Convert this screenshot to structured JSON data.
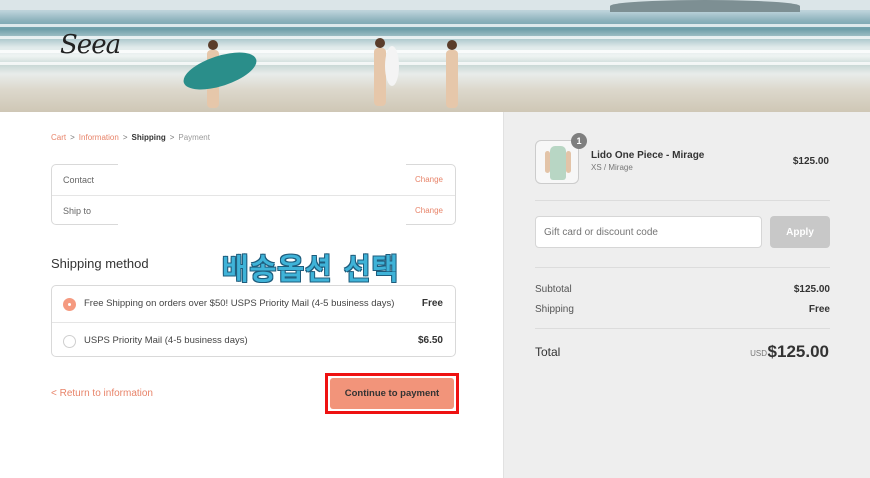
{
  "brand": {
    "logo": "Seea"
  },
  "breadcrumb": [
    {
      "label": "Cart",
      "state": "link"
    },
    {
      "label": "Information",
      "state": "link"
    },
    {
      "label": "Shipping",
      "state": "current"
    },
    {
      "label": "Payment",
      "state": "upcoming"
    }
  ],
  "review": {
    "contact_label": "Contact",
    "ship_to_label": "Ship to",
    "change_label": "Change"
  },
  "shipping": {
    "title": "Shipping method",
    "annotation": "배송옵션 선택",
    "options": [
      {
        "label": "Free Shipping on orders over $50! USPS Priority Mail (4-5 business days)",
        "price": "Free",
        "selected": true
      },
      {
        "label": "USPS Priority Mail (4-5 business days)",
        "price": "$6.50",
        "selected": false
      }
    ]
  },
  "actions": {
    "return_label": "< Return to information",
    "continue_label": "Continue to payment"
  },
  "summary": {
    "item": {
      "quantity": "1",
      "name": "Lido One Piece - Mirage",
      "variant": "XS / Mirage",
      "price": "$125.00"
    },
    "discount_placeholder": "Gift card or discount code",
    "apply_label": "Apply",
    "subtotal_label": "Subtotal",
    "subtotal_value": "$125.00",
    "shipping_label": "Shipping",
    "shipping_value": "Free",
    "total_label": "Total",
    "currency": "USD",
    "total_value": "$125.00"
  },
  "colors": {
    "accent": "#e8846a",
    "button": "#f2947a",
    "highlight_frame": "#ee1111",
    "annotation": "#3fb3d8"
  }
}
